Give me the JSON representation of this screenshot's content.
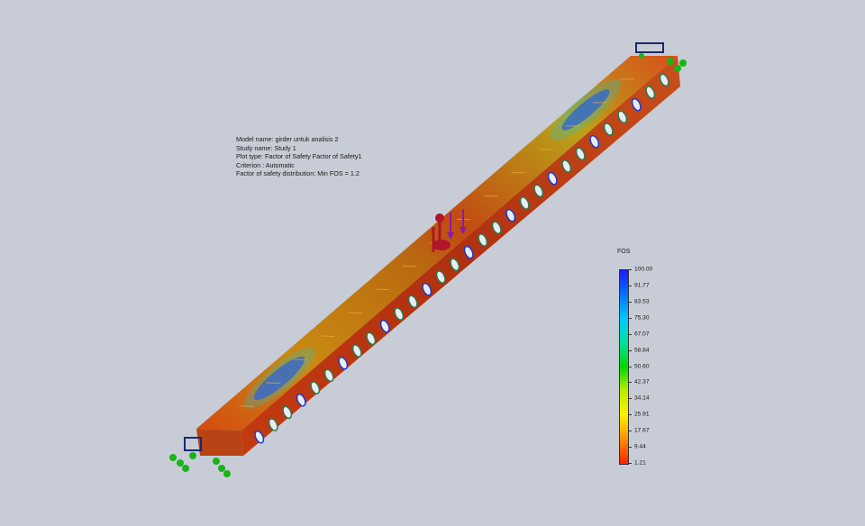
{
  "model_info": {
    "model_name": "Model name: girder untuk analisis 2",
    "study_name": "Study name: Study 1",
    "plot_type": "Plot type: Factor of Safety Factor of Safety1",
    "criterion": "Criterion : Automatic",
    "distribution": "Factor of safety distribution: Min FOS = 1.2"
  },
  "legend": {
    "title": "FOS",
    "ticks": [
      "100.00",
      "91.77",
      "83.53",
      "75.30",
      "67.07",
      "58.84",
      "50.60",
      "42.37",
      "34.14",
      "25.91",
      "17.67",
      "9.44",
      "1.21"
    ],
    "colors": [
      "#1a1aff",
      "#0070ff",
      "#00c8ff",
      "#00e0a0",
      "#00d800",
      "#b8ee00",
      "#ffee00",
      "#ff9000",
      "#ff2000"
    ]
  },
  "scene": {
    "background": "#c8ccd6",
    "fixture_color": "#18b418",
    "load_color": "#8a1aa8"
  }
}
